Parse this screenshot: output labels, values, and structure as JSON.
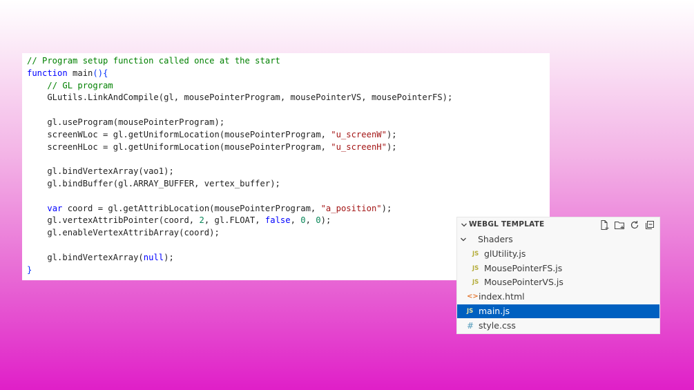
{
  "code_editor": {
    "lines": [
      [
        {
          "t": "// Program setup function called once at the start",
          "c": "comment"
        }
      ],
      [
        {
          "t": "function",
          "c": "keyword"
        },
        {
          "t": " main"
        },
        {
          "t": "()",
          "c": "brace"
        },
        {
          "t": "{",
          "c": "brace"
        }
      ],
      [
        {
          "t": "    "
        },
        {
          "t": "// GL program",
          "c": "comment"
        }
      ],
      [
        {
          "t": "    GLutils.LinkAndCompile(gl, mousePointerProgram, mousePointerVS, mousePointerFS);"
        }
      ],
      [
        {
          "t": ""
        }
      ],
      [
        {
          "t": "    gl.useProgram(mousePointerProgram);"
        }
      ],
      [
        {
          "t": "    screenWLoc = gl.getUniformLocation(mousePointerProgram, "
        },
        {
          "t": "\"u_screenW\"",
          "c": "string"
        },
        {
          "t": ");"
        }
      ],
      [
        {
          "t": "    screenHLoc = gl.getUniformLocation(mousePointerProgram, "
        },
        {
          "t": "\"u_screenH\"",
          "c": "string"
        },
        {
          "t": ");"
        }
      ],
      [
        {
          "t": ""
        }
      ],
      [
        {
          "t": "    gl.bindVertexArray(vao1);"
        }
      ],
      [
        {
          "t": "    gl.bindBuffer(gl.ARRAY_BUFFER, vertex_buffer);"
        }
      ],
      [
        {
          "t": ""
        }
      ],
      [
        {
          "t": "    "
        },
        {
          "t": "var",
          "c": "keyword"
        },
        {
          "t": " coord = gl.getAttribLocation(mousePointerProgram, "
        },
        {
          "t": "\"a_position\"",
          "c": "string"
        },
        {
          "t": ");"
        }
      ],
      [
        {
          "t": "    gl.vertexAttribPointer(coord, "
        },
        {
          "t": "2",
          "c": "number"
        },
        {
          "t": ", gl.FLOAT, "
        },
        {
          "t": "false",
          "c": "keyword"
        },
        {
          "t": ", "
        },
        {
          "t": "0",
          "c": "number"
        },
        {
          "t": ", "
        },
        {
          "t": "0",
          "c": "number"
        },
        {
          "t": ");"
        }
      ],
      [
        {
          "t": "    gl.enableVertexAttribArray(coord);"
        }
      ],
      [
        {
          "t": ""
        }
      ],
      [
        {
          "t": "    gl.bindVertexArray("
        },
        {
          "t": "null",
          "c": "keyword"
        },
        {
          "t": ");"
        }
      ],
      [
        {
          "t": "}",
          "c": "brace"
        }
      ]
    ]
  },
  "explorer": {
    "title": "WEBGL TEMPLATE",
    "header_icons": [
      "new-file-icon",
      "new-folder-icon",
      "refresh-icon",
      "collapse-all-icon"
    ],
    "items": [
      {
        "label": "Shaders",
        "kind": "folder",
        "icon": "chevron-down-icon",
        "depth": 0,
        "selected": false
      },
      {
        "label": "glUtility.js",
        "kind": "js",
        "icon": "JS",
        "depth": 1,
        "selected": false
      },
      {
        "label": "MousePointerFS.js",
        "kind": "js",
        "icon": "JS",
        "depth": 1,
        "selected": false
      },
      {
        "label": "MousePointerVS.js",
        "kind": "js",
        "icon": "JS",
        "depth": 1,
        "selected": false
      },
      {
        "label": "index.html",
        "kind": "html",
        "icon": "<>",
        "depth": 0,
        "selected": false
      },
      {
        "label": "main.js",
        "kind": "js",
        "icon": "JS",
        "depth": 0,
        "selected": true
      },
      {
        "label": "style.css",
        "kind": "css",
        "icon": "#",
        "depth": 0,
        "selected": false
      }
    ]
  },
  "colors": {
    "background_top": "#ffffff",
    "background_bottom": "#e01fc8",
    "selection": "#0060c0",
    "comment": "#008000",
    "keyword": "#0000ff",
    "string": "#a31515",
    "number": "#098658"
  }
}
